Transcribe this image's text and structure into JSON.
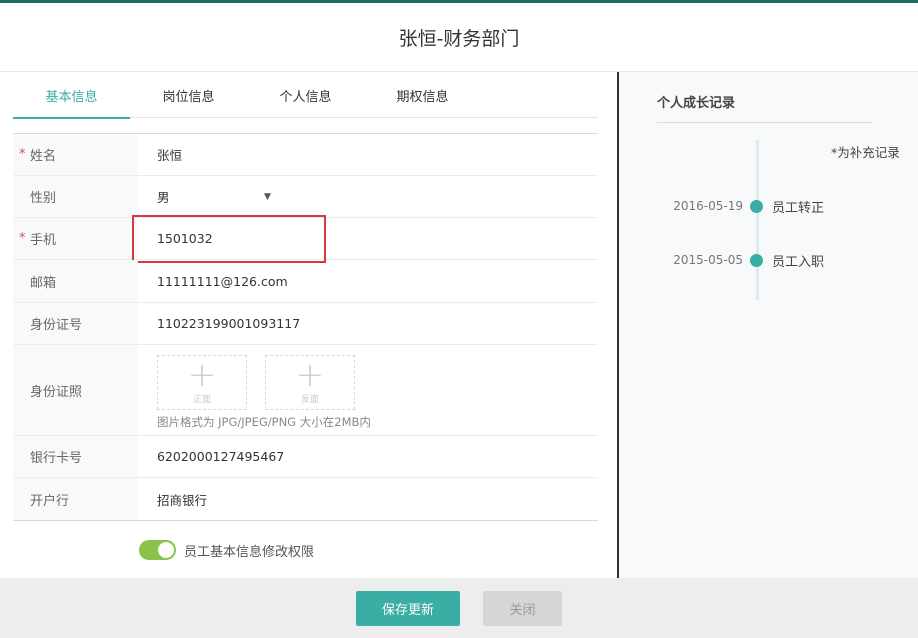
{
  "header": {
    "title": "张恒-财务部门"
  },
  "tabs": [
    {
      "label": "基本信息",
      "active": true
    },
    {
      "label": "岗位信息",
      "active": false
    },
    {
      "label": "个人信息",
      "active": false
    },
    {
      "label": "期权信息",
      "active": false
    }
  ],
  "form": {
    "name": {
      "label": "姓名",
      "required": "*",
      "value": "张恒"
    },
    "gender": {
      "label": "性别",
      "value": "男",
      "caret": "▼"
    },
    "phone": {
      "label": "手机",
      "required": "*",
      "value": "1501032"
    },
    "email": {
      "label": "邮箱",
      "value": "11111111@126.com"
    },
    "id_number": {
      "label": "身份证号",
      "value": "110223199001093117"
    },
    "id_photo": {
      "label": "身份证照",
      "front": "正面",
      "back": "反面",
      "plus": "+",
      "hint": "图片格式为 JPG/JPEG/PNG 大小在2MB内"
    },
    "bank_card": {
      "label": "银行卡号",
      "value": "6202000127495467"
    },
    "bank": {
      "label": "开户行",
      "value": "招商银行"
    }
  },
  "permission": {
    "label": "员工基本信息修改权限",
    "enabled": true
  },
  "growth": {
    "title": "个人成长记录",
    "supplement_note": "*为补充记录",
    "events": [
      {
        "date": "2016-05-19",
        "event": "员工转正"
      },
      {
        "date": "2015-05-05",
        "event": "员工入职"
      }
    ]
  },
  "footer": {
    "save_label": "保存更新",
    "close_label": "关闭"
  },
  "colors": {
    "accent": "#3aada5",
    "topbar": "#1e6f63",
    "toggle_on": "#8bc34a",
    "required": "#e5484d",
    "highlight_box": "#d9363e"
  }
}
